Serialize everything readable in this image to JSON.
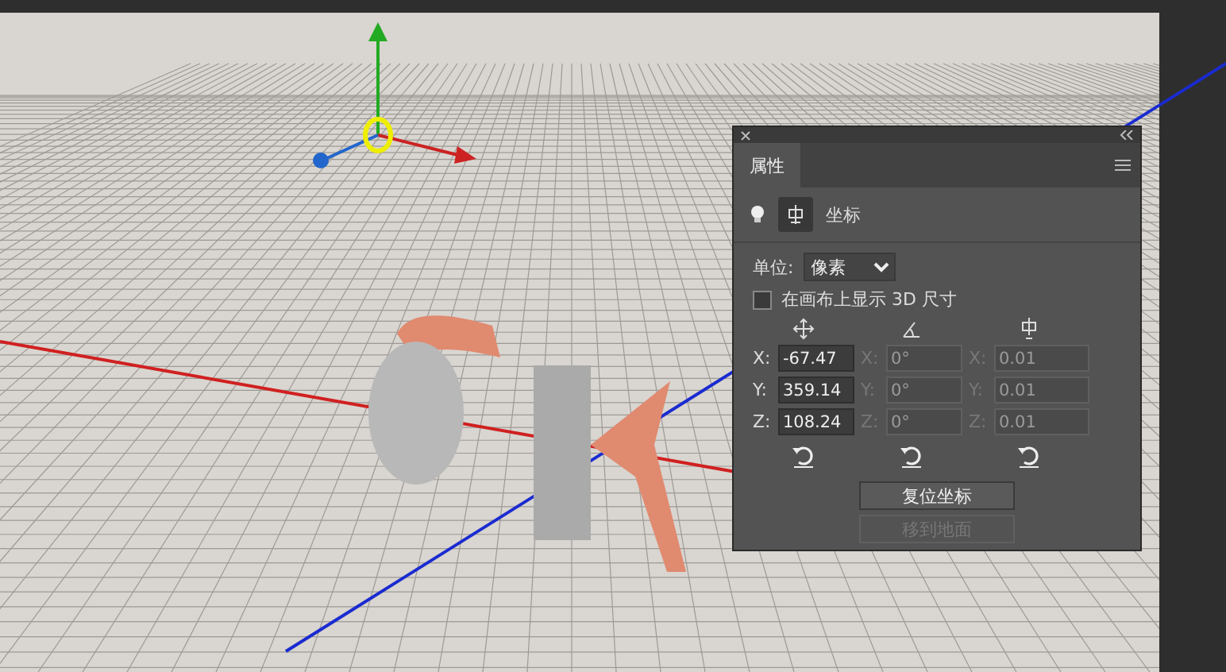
{
  "panel": {
    "tabs": [
      {
        "label": "属性",
        "selected": true
      }
    ],
    "section_title": "坐标",
    "unit": {
      "label": "单位:",
      "value": "像素"
    },
    "show_3d_size": {
      "label": "在画布上显示 3D 尺寸",
      "checked": false
    },
    "groups": [
      {
        "kind": "position",
        "fields": [
          {
            "axis": "X:",
            "value": "-67.47",
            "disabled": false
          },
          {
            "axis": "Y:",
            "value": "359.14",
            "disabled": false
          },
          {
            "axis": "Z:",
            "value": "108.24",
            "disabled": false
          }
        ]
      },
      {
        "kind": "rotation",
        "fields": [
          {
            "axis": "X:",
            "value": "0°",
            "disabled": true
          },
          {
            "axis": "Y:",
            "value": "0°",
            "disabled": true
          },
          {
            "axis": "Z:",
            "value": "0°",
            "disabled": true
          }
        ]
      },
      {
        "kind": "scale",
        "fields": [
          {
            "axis": "X:",
            "value": "0.01",
            "disabled": true
          },
          {
            "axis": "Y:",
            "value": "0.01",
            "disabled": true
          },
          {
            "axis": "Z:",
            "value": "0.01",
            "disabled": true
          }
        ]
      }
    ],
    "buttons": [
      {
        "label": "复位坐标",
        "disabled": false
      },
      {
        "label": "移到地面",
        "disabled": true
      }
    ]
  }
}
